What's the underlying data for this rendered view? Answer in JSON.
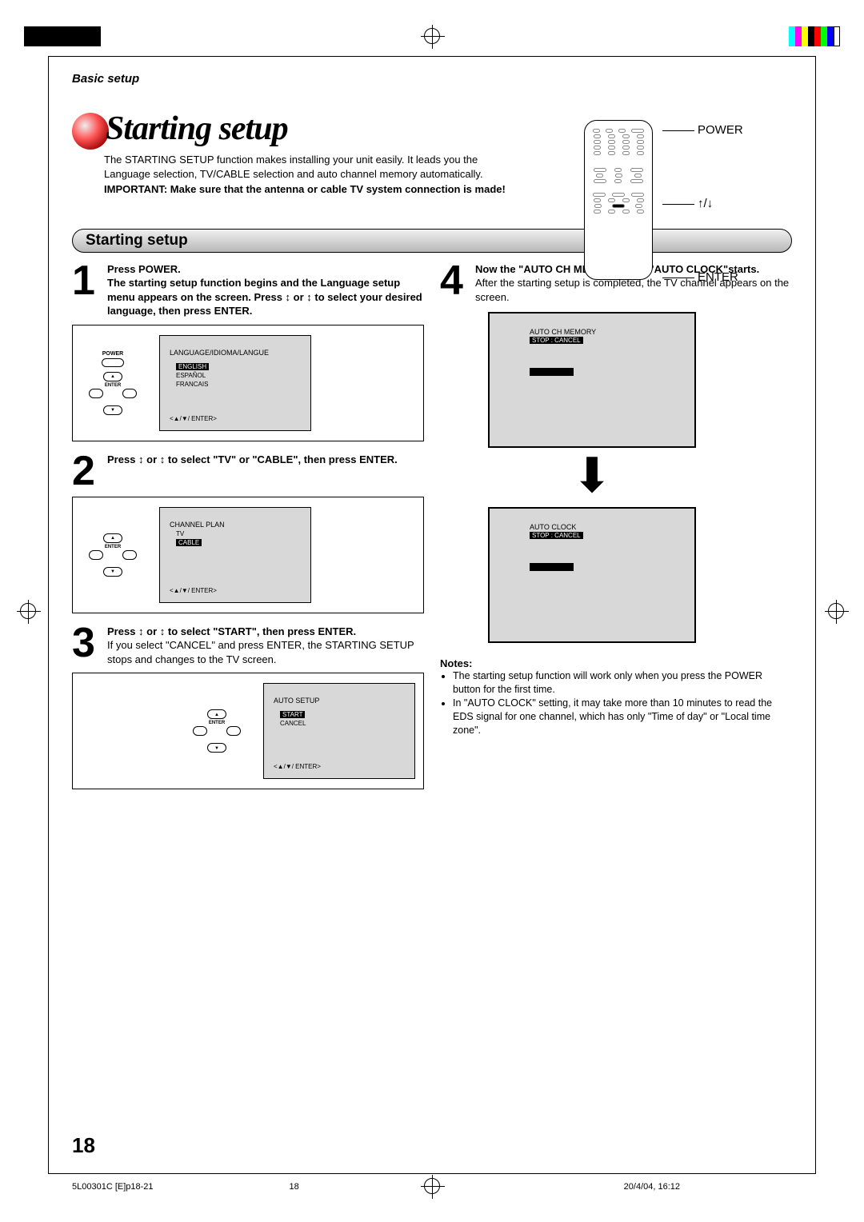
{
  "header": {
    "section_label": "Basic setup"
  },
  "title": "Starting setup",
  "intro": {
    "p1": "The STARTING SETUP function makes installing your unit easily. It leads you the Language selection, TV/CABLE selection and auto channel memory automatically.",
    "important": "IMPORTANT: Make sure that the antenna or cable TV system connection is made!"
  },
  "remote_labels": {
    "power": "POWER",
    "arrows": "↨",
    "enter": "ENTER"
  },
  "section_heading": "Starting setup",
  "steps": {
    "s1": {
      "num": "1",
      "line1": "Press POWER.",
      "line2": "The starting setup function begins and the Language setup menu appears on the screen. Press ↕ or ↕ to select your desired language, then press ENTER."
    },
    "s2": {
      "num": "2",
      "text": "Press ↕ or ↕ to select \"TV\" or \"CABLE\", then press ENTER."
    },
    "s3": {
      "num": "3",
      "text": "Press ↕ or ↕ to select \"START\", then press ENTER.",
      "body": "If you select \"CANCEL\" and press ENTER, the STARTING SETUP stops and changes to the TV screen."
    },
    "s4": {
      "num": "4",
      "text": "Now the \"AUTO CH MEMORY\" and \"AUTO CLOCK\"starts.",
      "body": "After the starting setup is completed, the TV channel appears on the screen."
    }
  },
  "screens": {
    "lang": {
      "title": "LANGUAGE/IDIOMA/LANGUE",
      "opt1": "ENGLISH",
      "opt2": "ESPAÑOL",
      "opt3": "FRANCAIS",
      "footer": "<▲/▼/ ENTER>"
    },
    "plan": {
      "title": "CHANNEL PLAN",
      "opt1": "TV",
      "opt2": "CABLE",
      "footer": "<▲/▼/ ENTER>"
    },
    "auto": {
      "title": "AUTO SETUP",
      "opt1": "START",
      "opt2": "CANCEL",
      "footer": "<▲/▼/ ENTER>"
    },
    "mem": {
      "title": "AUTO CH MEMORY",
      "sub": "STOP : CANCEL"
    },
    "clock": {
      "title": "AUTO CLOCK",
      "sub": "STOP : CANCEL"
    }
  },
  "mini_remote": {
    "power": "POWER",
    "enter": "ENTER"
  },
  "notes": {
    "title": "Notes:",
    "n1": "The starting setup function will work only when you press the POWER button for the first time.",
    "n2": "In \"AUTO CLOCK\" setting, it may take more than 10 minutes to read the EDS signal for one channel, which has only \"Time of day\" or \"Local time zone\"."
  },
  "page_number": "18",
  "footer": {
    "file": "5L00301C [E]p18-21",
    "page": "18",
    "date": "20/4/04, 16:12"
  }
}
